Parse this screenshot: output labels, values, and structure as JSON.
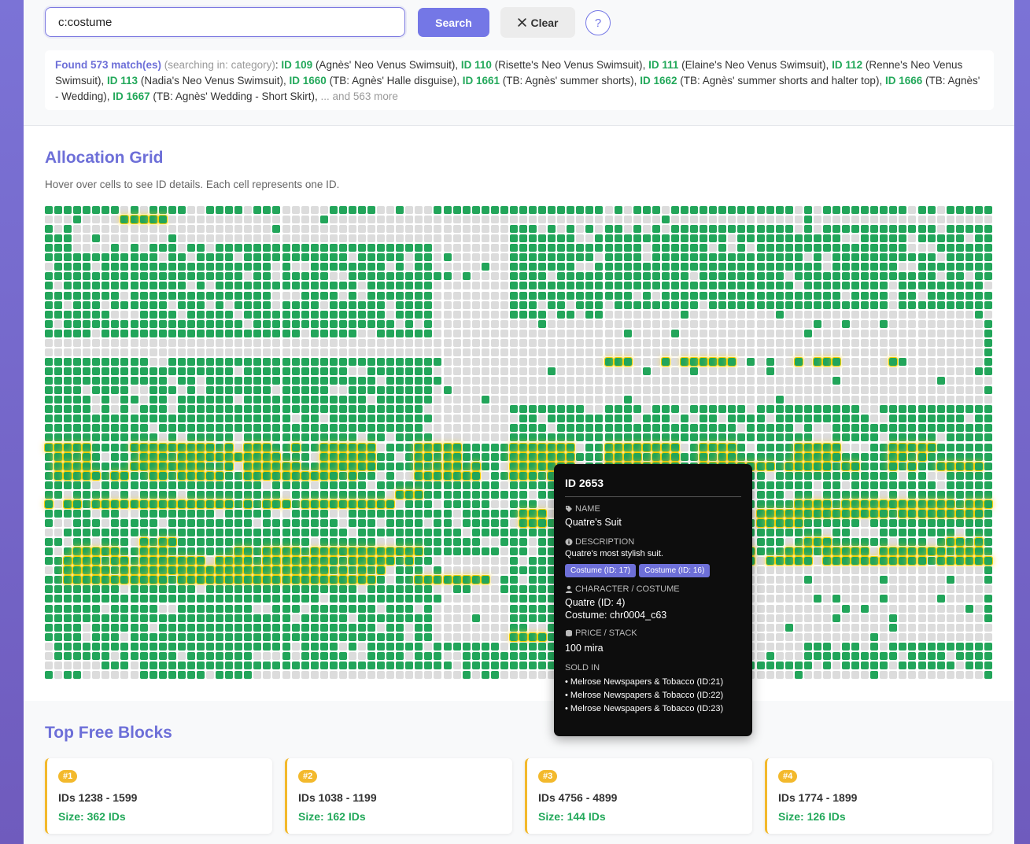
{
  "search": {
    "value": "c:costume",
    "search_label": "Search",
    "clear_label": "Clear",
    "help_label": "?"
  },
  "results": {
    "found": "Found 573 match(es)",
    "searching": "(searching in: category)",
    "items": [
      {
        "id": "ID 109",
        "name": "(Agnès' Neo Venus Swimsuit)"
      },
      {
        "id": "ID 110",
        "name": "(Risette's Neo Venus Swimsuit)"
      },
      {
        "id": "ID 111",
        "name": "(Elaine's Neo Venus Swimsuit)"
      },
      {
        "id": "ID 112",
        "name": "(Renne's Neo Venus Swimsuit)"
      },
      {
        "id": "ID 113",
        "name": "(Nadia's Neo Venus Swimsuit)"
      },
      {
        "id": "ID 1660",
        "name": "(TB: Agnès' Halle disguise)"
      },
      {
        "id": "ID 1661",
        "name": "(TB: Agnès' summer shorts)"
      },
      {
        "id": "ID 1662",
        "name": "(TB: Agnès' summer shorts and halter top)"
      },
      {
        "id": "ID 1666",
        "name": "(TB: Agnès' - Wedding)"
      },
      {
        "id": "ID 1667",
        "name": "(TB: Agnès' Wedding - Short Skirt)"
      }
    ],
    "more": "... and 563 more"
  },
  "grid": {
    "title": "Allocation Grid",
    "hint": "Hover over cells to see ID details. Each cell represents one ID."
  },
  "tooltip": {
    "title": "ID 2653",
    "name_label": "NAME",
    "name": "Quatre's Suit",
    "desc_label": "DESCRIPTION",
    "desc": "Quatre's most stylish suit.",
    "tags": [
      "Costume (ID: 17)",
      "Costume (ID: 16)"
    ],
    "char_label": "CHARACTER / COSTUME",
    "character": "Quatre (ID: 4)",
    "costume": "Costume: chr0004_c63",
    "price_label": "PRICE / STACK",
    "price": "100 mira",
    "sold_label": "SOLD IN",
    "sold": [
      "• Melrose Newspapers & Tobacco (ID:21)",
      "• Melrose Newspapers & Tobacco (ID:22)",
      "• Melrose Newspapers & Tobacco (ID:23)"
    ]
  },
  "blocks": {
    "title": "Top Free Blocks",
    "items": [
      {
        "rank": "#1",
        "range": "IDs 1238 - 1599",
        "size": "Size: 362 IDs"
      },
      {
        "rank": "#2",
        "range": "IDs 1038 - 1199",
        "size": "Size: 162 IDs"
      },
      {
        "rank": "#3",
        "range": "IDs 4756 - 4899",
        "size": "Size: 144 IDs"
      },
      {
        "rank": "#4",
        "range": "IDs 1774 - 1899",
        "size": "Size: 126 IDs"
      }
    ]
  },
  "colors": {
    "accent": "#6d6fd8",
    "used": "#22a55a",
    "free": "#dcdcdc",
    "highlight": "#f5d000"
  }
}
